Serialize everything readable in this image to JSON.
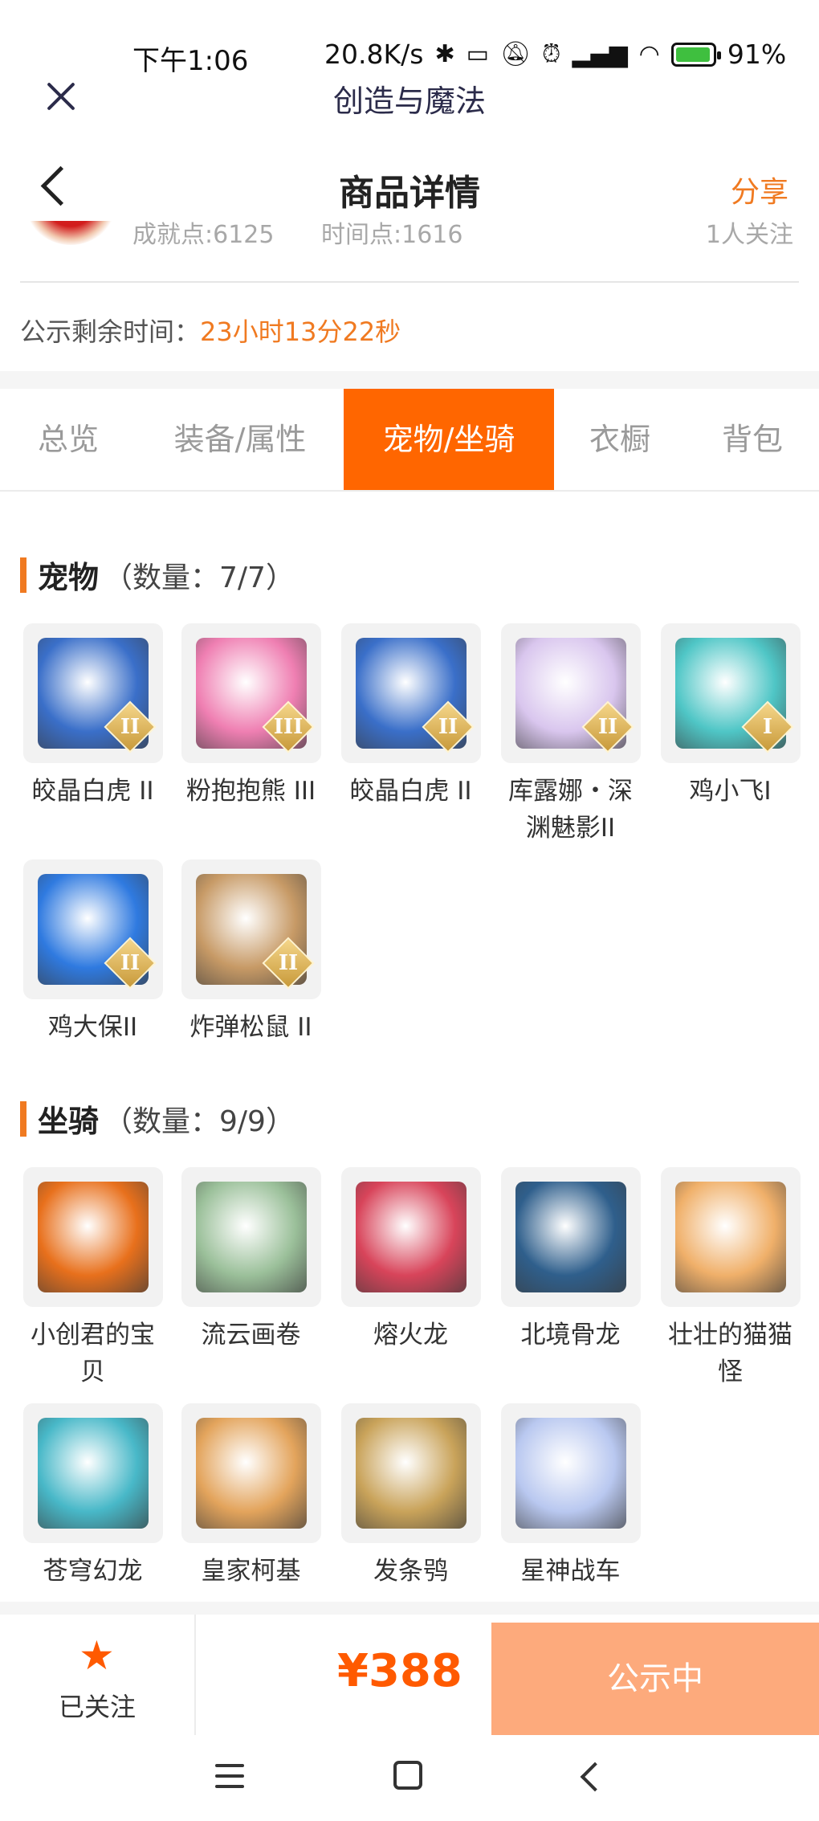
{
  "status_bar": {
    "time": "下午1:06",
    "net_speed": "20.8K/s",
    "battery_percent": "91%"
  },
  "mini_title": {
    "text": "创造与魔法"
  },
  "header": {
    "title": "商品详情",
    "share_label": "分享"
  },
  "peek_row": {
    "achievement": "成就点:6125",
    "time_points": "时间点:1616",
    "followers": "1人关注"
  },
  "countdown": {
    "label": "公示剩余时间：",
    "value": "23小时13分22秒"
  },
  "tabs": [
    {
      "label": "总览",
      "active": false
    },
    {
      "label": "装备/属性",
      "active": false
    },
    {
      "label": "宠物/坐骑",
      "active": true
    },
    {
      "label": "衣橱",
      "active": false
    },
    {
      "label": "背包",
      "active": false
    }
  ],
  "pets": {
    "title": "宠物",
    "count": "（数量：7/7）",
    "items": [
      {
        "name": "皎晶白虎 II",
        "badge": "II",
        "icon": "white-tiger-icon",
        "color": "#3a6fc9"
      },
      {
        "name": "粉抱抱熊 III",
        "badge": "III",
        "icon": "pink-bear-icon",
        "color": "#ef7fb2"
      },
      {
        "name": "皎晶白虎 II",
        "badge": "II",
        "icon": "white-tiger-icon",
        "color": "#3a6fc9"
      },
      {
        "name": "库露娜・深渊魅影II",
        "badge": "II",
        "icon": "kuluna-icon",
        "color": "#d9c6ee"
      },
      {
        "name": "鸡小飞I",
        "badge": "I",
        "icon": "chick-icon",
        "color": "#4fc6c6"
      },
      {
        "name": "鸡大保II",
        "badge": "II",
        "icon": "blue-chicken-icon",
        "color": "#2f7ae0"
      },
      {
        "name": "炸弹松鼠 II",
        "badge": "II",
        "icon": "bomb-squirrel-icon",
        "color": "#c79a66"
      }
    ]
  },
  "mounts": {
    "title": "坐骑",
    "count": "（数量：9/9）",
    "items": [
      {
        "name": "小创君的宝贝",
        "icon": "phoenix-icon",
        "color": "#e8701c"
      },
      {
        "name": "流云画卷",
        "icon": "bamboo-scroll-icon",
        "color": "#9bc09a"
      },
      {
        "name": "熔火龙",
        "icon": "lava-dragon-icon",
        "color": "#d8445a"
      },
      {
        "name": "北境骨龙",
        "icon": "bone-dragon-icon",
        "color": "#2f5f8c"
      },
      {
        "name": "壮壮的猫猫怪",
        "icon": "cat-monster-icon",
        "color": "#f0b06a"
      },
      {
        "name": "苍穹幻龙",
        "icon": "sky-dragon-icon",
        "color": "#48b8c8"
      },
      {
        "name": "皇家柯基",
        "icon": "royal-corgi-icon",
        "color": "#e3a45c"
      },
      {
        "name": "发条鸮",
        "icon": "clockwork-owl-icon",
        "color": "#c9a35a"
      },
      {
        "name": "星神战车",
        "icon": "star-chariot-icon",
        "color": "#b9c8f0"
      }
    ]
  },
  "bottom": {
    "follow_label": "已关注",
    "price": "¥388",
    "status_label": "公示中"
  },
  "colors": {
    "accent": "#ff6600",
    "price": "#ff5a00",
    "highlight": "#f07a21",
    "status_button": "#fdaa7c"
  }
}
